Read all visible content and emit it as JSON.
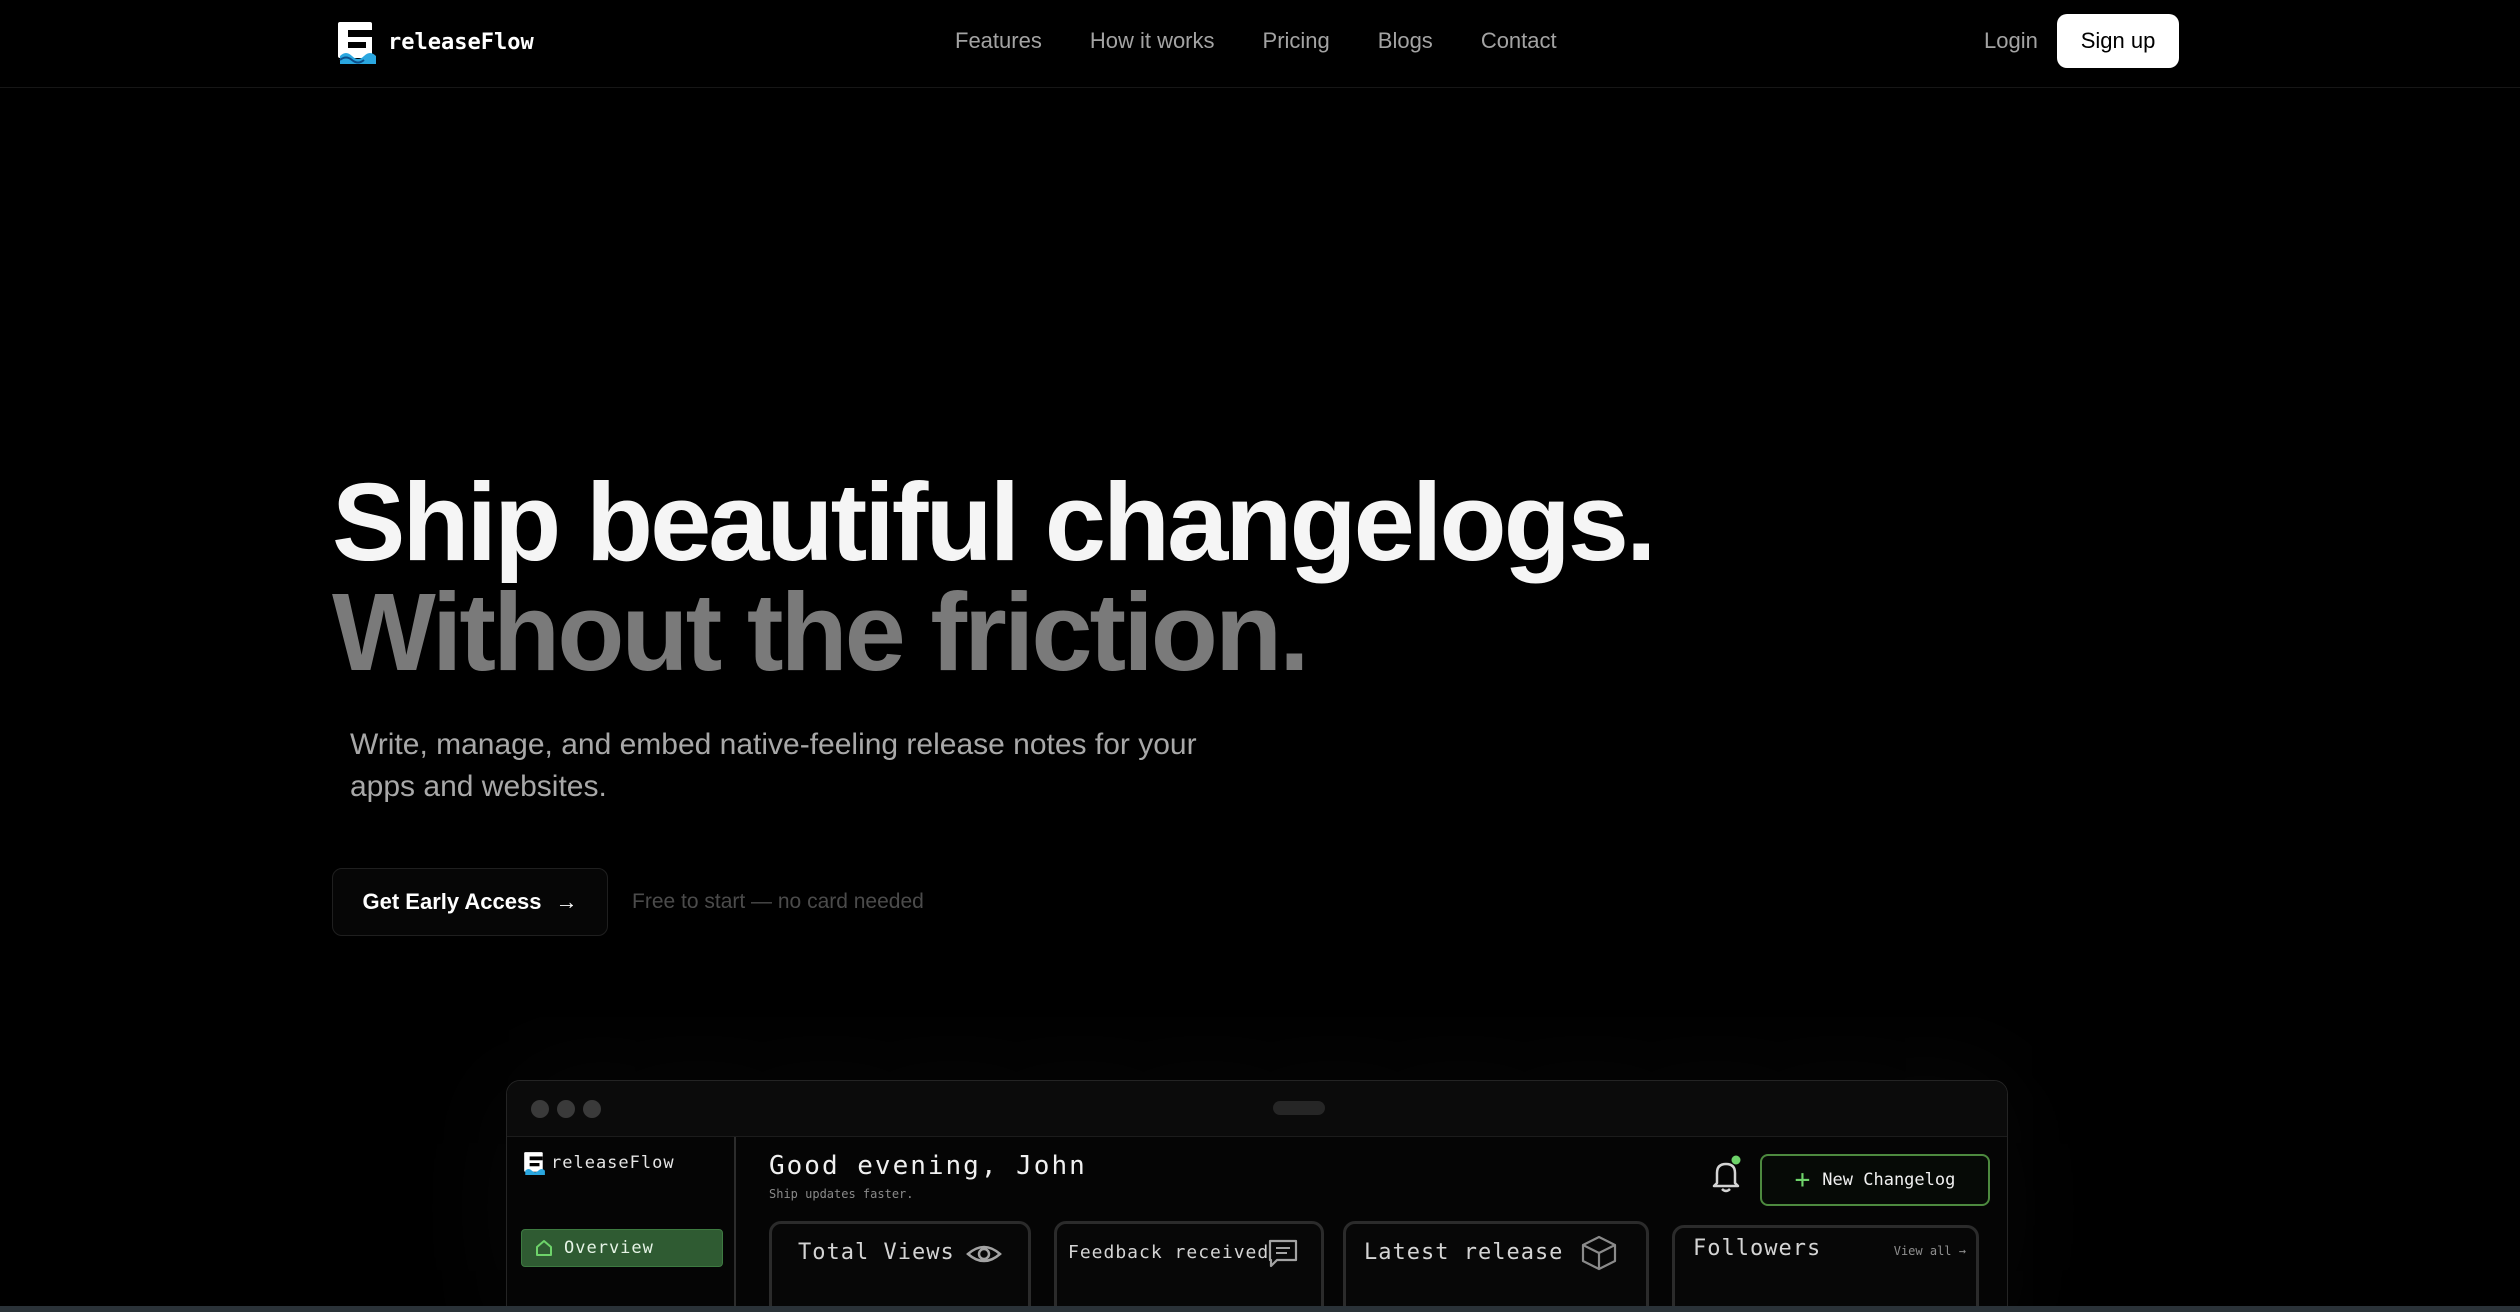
{
  "brand": {
    "name": "releaseFlow"
  },
  "nav": {
    "links": [
      "Features",
      "How it works",
      "Pricing",
      "Blogs",
      "Contact"
    ],
    "login": "Login",
    "signup": "Sign up"
  },
  "hero": {
    "line1": "Ship beautiful changelogs.",
    "line2": "Without the friction.",
    "subtitle": "Write, manage, and embed native-feeling release notes for your apps and websites.",
    "cta": "Get Early Access",
    "cta_note": "Free to start — no card needed"
  },
  "preview": {
    "brand": "releaseFlow",
    "sidebar": {
      "active_item": "Overview"
    },
    "greeting": "Good evening, John",
    "tagline": "Ship updates faster.",
    "new_button": "New Changelog",
    "cards": [
      {
        "title": "Total Views",
        "icon": "eye-icon"
      },
      {
        "title": "Feedback received",
        "icon": "message-icon"
      },
      {
        "title": "Latest release",
        "icon": "box-icon"
      },
      {
        "title": "Followers",
        "link": "View all"
      }
    ]
  },
  "colors": {
    "background": "#000000",
    "accent_green": "#6ed36a",
    "sidebar_active": "#2f5b32"
  }
}
